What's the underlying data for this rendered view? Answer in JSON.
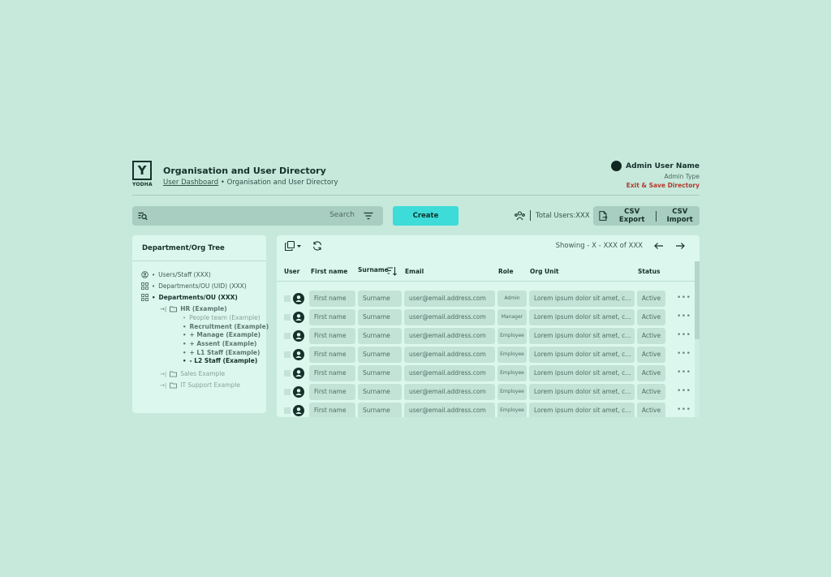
{
  "brand": {
    "logo_letter": "Y",
    "name": "YODHA"
  },
  "header": {
    "title": "Organisation and User Directory",
    "breadcrumb_link": "User Dashboard",
    "breadcrumb_sep": " • ",
    "breadcrumb_current": "Organisation and User Directory",
    "user_name": "Admin User Name",
    "user_type": "Admin Type",
    "exit_label": "Exit & Save Directory"
  },
  "toolbar": {
    "search_placeholder": "Search",
    "create_label": "Create",
    "total_users": "Total Users:XXX",
    "csv_export": "CSV Export",
    "csv_import": "CSV Import"
  },
  "tree": {
    "title": "Department/Org Tree",
    "items": [
      {
        "label": "Users/Staff (XXX)"
      },
      {
        "label": "Departments/OU (UID) (XXX)"
      },
      {
        "label": "Departments/OU (XXX)"
      },
      {
        "label": "HR (Example)"
      },
      {
        "label": "People team (Example)"
      },
      {
        "label": "Recruitment (Example)"
      },
      {
        "label": "+ Manage (Example)"
      },
      {
        "label": "+ Assent  (Example)"
      },
      {
        "label": "+ L1 Staff  (Example)"
      },
      {
        "label": "- L2 Staff  (Example)"
      },
      {
        "label": "Sales Example"
      },
      {
        "label": "IT Support Example"
      }
    ]
  },
  "table": {
    "showing": "Showing - X - XXX of XXX",
    "columns": {
      "user": "User",
      "first": "First name",
      "surname": "Surname",
      "email": "Email",
      "role": "Role",
      "org": "Org Unit",
      "status": "Status"
    },
    "rows": [
      {
        "first": "First name",
        "surname": "Surname",
        "email": "user@email.address.com",
        "role": "Admin",
        "org": "Lorem ipsum dolor sit amet, consectetur",
        "status": "Active"
      },
      {
        "first": "First name",
        "surname": "Surname",
        "email": "user@email.address.com",
        "role": "Manager",
        "org": "Lorem ipsum dolor sit amet, consectetur",
        "status": "Active"
      },
      {
        "first": "First name",
        "surname": "Surname",
        "email": "user@email.address.com",
        "role": "Employee",
        "org": "Lorem ipsum dolor sit amet, consectetur",
        "status": "Active"
      },
      {
        "first": "First name",
        "surname": "Surname",
        "email": "user@email.address.com",
        "role": "Employee",
        "org": "Lorem ipsum dolor sit amet, consectetur",
        "status": "Active"
      },
      {
        "first": "First name",
        "surname": "Surname",
        "email": "user@email.address.com",
        "role": "Employee",
        "org": "Lorem ipsum dolor sit amet, consectetur",
        "status": "Active"
      },
      {
        "first": "First name",
        "surname": "Surname",
        "email": "user@email.address.com",
        "role": "Employee",
        "org": "Lorem ipsum dolor sit amet, consectetur",
        "status": "Active"
      },
      {
        "first": "First name",
        "surname": "Surname",
        "email": "user@email.address.com",
        "role": "Employee",
        "org": "Lorem ipsum dolor sit amet, consectetur",
        "status": "Active"
      }
    ],
    "row_menu": "•••"
  },
  "colors": {
    "background": "#c6e9dc",
    "panel": "#dcf8ee",
    "accent": "#3ddcd8",
    "danger": "#b23a2e",
    "dark": "#16302a"
  }
}
